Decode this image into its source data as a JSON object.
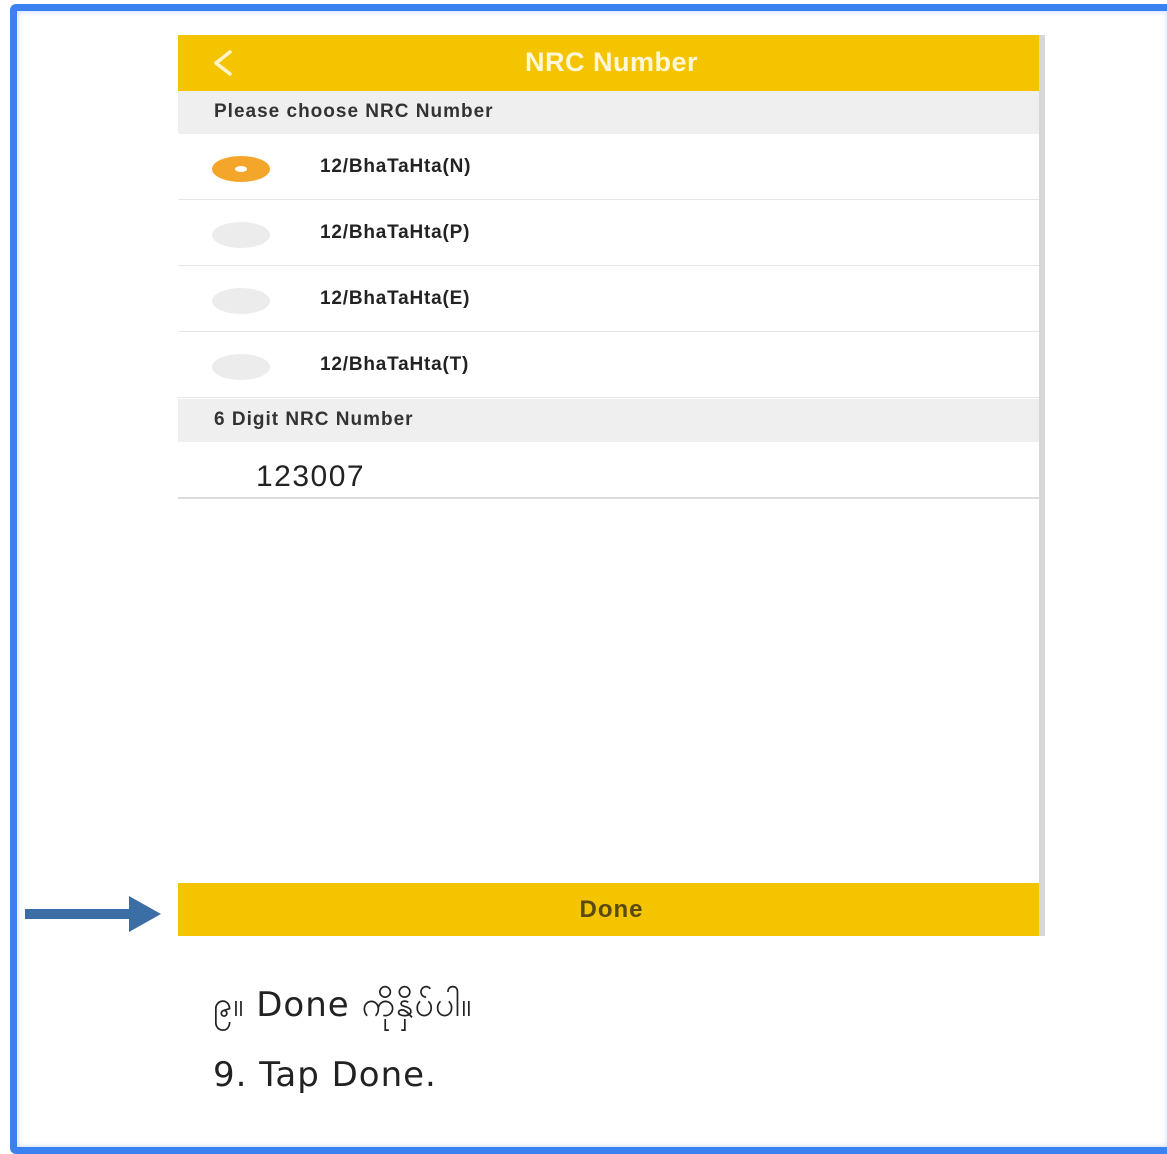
{
  "header": {
    "title": "NRC Number",
    "back_icon": "chevron-left-icon"
  },
  "nrc_section": {
    "label": "Please choose NRC Number",
    "options": [
      {
        "label": "12/BhaTaHta(N)",
        "selected": true
      },
      {
        "label": "12/BhaTaHta(P)",
        "selected": false
      },
      {
        "label": "12/BhaTaHta(E)",
        "selected": false
      },
      {
        "label": "12/BhaTaHta(T)",
        "selected": false
      }
    ]
  },
  "digit_section": {
    "label": "6 Digit NRC Number",
    "value": "123007"
  },
  "done_button": {
    "label": "Done"
  },
  "instructions": {
    "burmese": "၉။ Done ကိုနှိပ်ပါ။",
    "english": "9. Tap Done."
  },
  "colors": {
    "accent": "#f5c400",
    "radio_selected": "#f4a62a",
    "frame": "#3b82f0",
    "arrow": "#3a6ea5"
  }
}
